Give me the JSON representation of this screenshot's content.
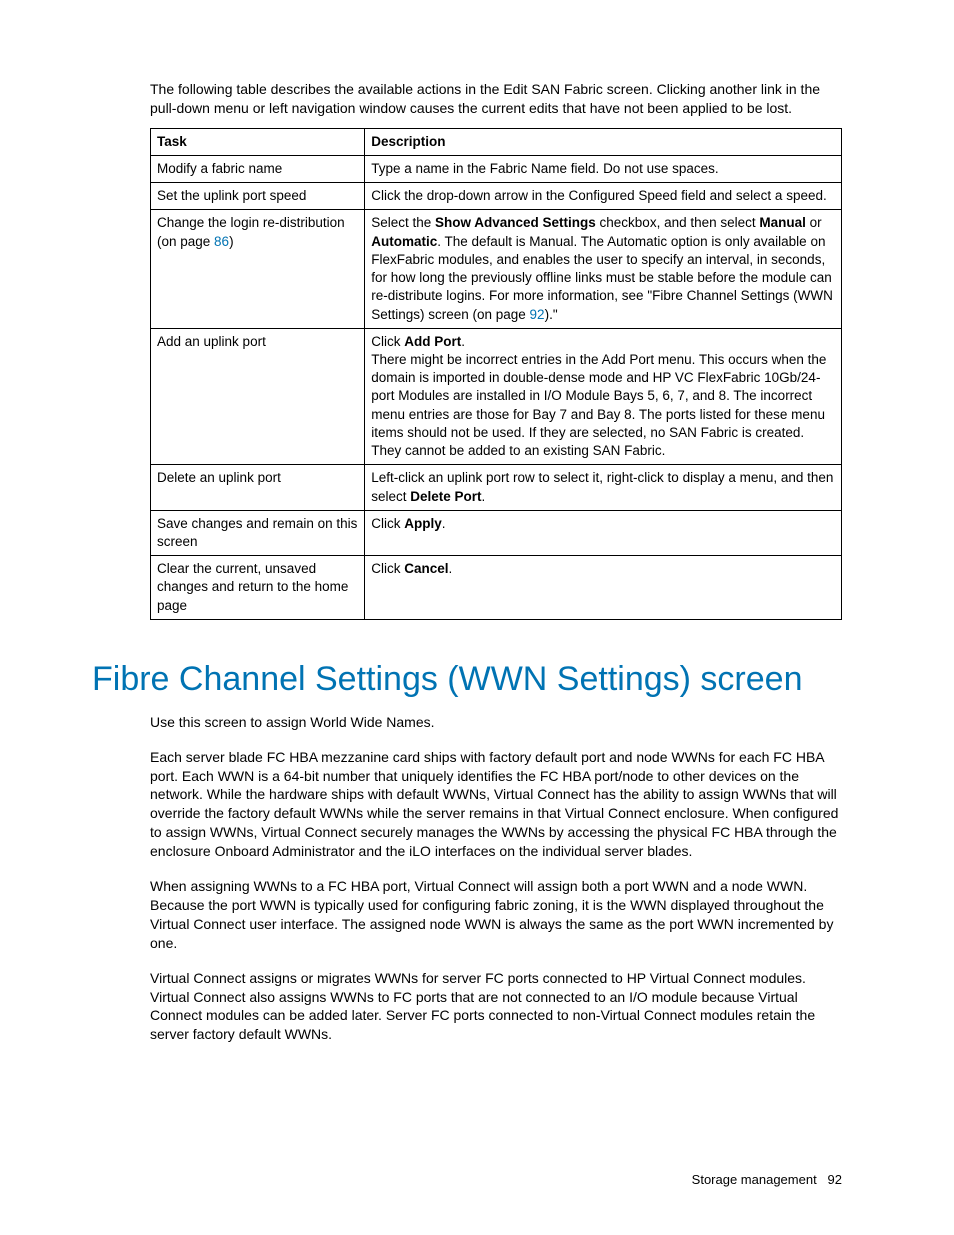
{
  "intro": "The following table describes the available actions in the Edit SAN Fabric screen. Clicking another link in the pull-down menu or left navigation window causes the current edits that have not been applied to be lost.",
  "table": {
    "headers": {
      "task": "Task",
      "description": "Description"
    },
    "rows": [
      {
        "task_pre": "Modify a fabric name",
        "desc_pre": "Type a name in the Fabric Name field. Do not use spaces."
      },
      {
        "task_pre": "Set the uplink port speed",
        "desc_pre": "Click the drop-down arrow in the Configured Speed field and select a speed."
      },
      {
        "task_pre": "Change the login re-distribution (on page ",
        "task_link": "86",
        "task_post": ")",
        "desc_pre": "Select the ",
        "desc_b1": "Show Advanced Settings",
        "desc_mid1": " checkbox, and then select ",
        "desc_b2": "Manual",
        "desc_mid2": " or ",
        "desc_b3": "Automatic",
        "desc_mid3": ". The default is Manual. The Automatic option is only available on FlexFabric modules, and enables the user to specify an interval, in seconds, for how long the previously offline links must be stable before the module can re-distribute logins. For more information, see \"Fibre Channel Settings (WWN Settings) screen (on page ",
        "desc_link": "92",
        "desc_post": ").\""
      },
      {
        "task_pre": "Add an uplink port",
        "desc_pre": "Click ",
        "desc_b1": "Add Port",
        "desc_mid1": ".\nThere might be incorrect entries in the Add Port menu. This occurs when the domain is imported in double-dense mode and HP VC FlexFabric 10Gb/24-port Modules are installed in I/O Module Bays 5, 6, 7, and 8. The incorrect menu entries are those for Bay 7 and Bay 8. The ports listed for these menu items should not be used. If they are selected, no SAN Fabric is created. They cannot be added to an existing SAN Fabric."
      },
      {
        "task_pre": "Delete an uplink port",
        "desc_pre": "Left-click an uplink port row to select it, right-click to display a menu, and then select ",
        "desc_b1": "Delete Port",
        "desc_mid1": "."
      },
      {
        "task_pre": "Save changes and remain on this screen",
        "desc_pre": "Click ",
        "desc_b1": "Apply",
        "desc_mid1": "."
      },
      {
        "task_pre": "Clear the current, unsaved changes and return to the home page",
        "desc_pre": "Click ",
        "desc_b1": "Cancel",
        "desc_mid1": "."
      }
    ]
  },
  "section_title": "Fibre Channel Settings (WWN Settings) screen",
  "para1": "Use this screen to assign World Wide Names.",
  "para2": "Each server blade FC HBA mezzanine card ships with factory default port and node WWNs for each FC HBA port. Each WWN is a 64-bit number that uniquely identifies the FC HBA port/node to other devices on the network. While the hardware ships with default WWNs, Virtual Connect has the ability to assign WWNs that will override the factory default WWNs while the server remains in that Virtual Connect enclosure. When configured to assign WWNs, Virtual Connect securely manages the WWNs by accessing the physical FC HBA through the enclosure Onboard Administrator and the iLO interfaces on the individual server blades.",
  "para3": "When assigning WWNs to a FC HBA port, Virtual Connect will assign both a port WWN and a node WWN. Because the port WWN is typically used for configuring fabric zoning, it is the WWN displayed throughout the Virtual Connect user interface. The assigned node WWN is always the same as the port WWN incremented by one.",
  "para4": "Virtual Connect assigns or migrates WWNs for server FC ports connected to HP Virtual Connect modules. Virtual Connect also assigns WWNs to FC ports that are not connected to an I/O module because Virtual Connect modules can be added later. Server FC ports connected to non-Virtual Connect modules retain the server factory default WWNs.",
  "footer_label": "Storage management",
  "footer_page": "92"
}
